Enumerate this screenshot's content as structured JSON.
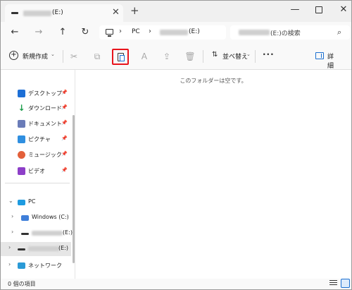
{
  "tab": {
    "label": "(E:)",
    "close": "✕",
    "add": "+"
  },
  "window": {
    "minimize": "—",
    "close": "✕"
  },
  "nav": {
    "back": "←",
    "forward": "→",
    "up": "↑",
    "refresh": "↻"
  },
  "address": {
    "sep": "›",
    "pc": "PC",
    "drive": "(E:)"
  },
  "search": {
    "placeholder": "(E:)の検索",
    "icon": "⌕"
  },
  "toolbar": {
    "new_label": "新規作成",
    "caret": "⌄",
    "cut": "✂",
    "copy": "⧉",
    "rename": "Ａ",
    "share": "⇪",
    "delete": "🗑",
    "sort_icon": "⇅",
    "sort_label": "並べ替え",
    "more": "···",
    "details_label": "詳細",
    "highlight_color": "#e8141c"
  },
  "sidebar": {
    "pin": "📌",
    "expand": "›",
    "collapse": "⌄",
    "quick_access": [
      {
        "label": "デスクトップ",
        "icon": "desktop-icon"
      },
      {
        "label": "ダウンロード",
        "icon": "download-icon"
      },
      {
        "label": "ドキュメント",
        "icon": "documents-icon"
      },
      {
        "label": "ピクチャ",
        "icon": "pictures-icon"
      },
      {
        "label": "ミュージック",
        "icon": "music-icon"
      },
      {
        "label": "ビデオ",
        "icon": "videos-icon"
      }
    ],
    "pc_label": "PC",
    "windows_label": "Windows (C:)",
    "drive_d_label": "(E:)",
    "drive_e_label": "(E:)",
    "network_label": "ネットワーク"
  },
  "content": {
    "empty_message": "このフォルダーは空です。"
  },
  "status": {
    "items": "0 個の項目"
  }
}
